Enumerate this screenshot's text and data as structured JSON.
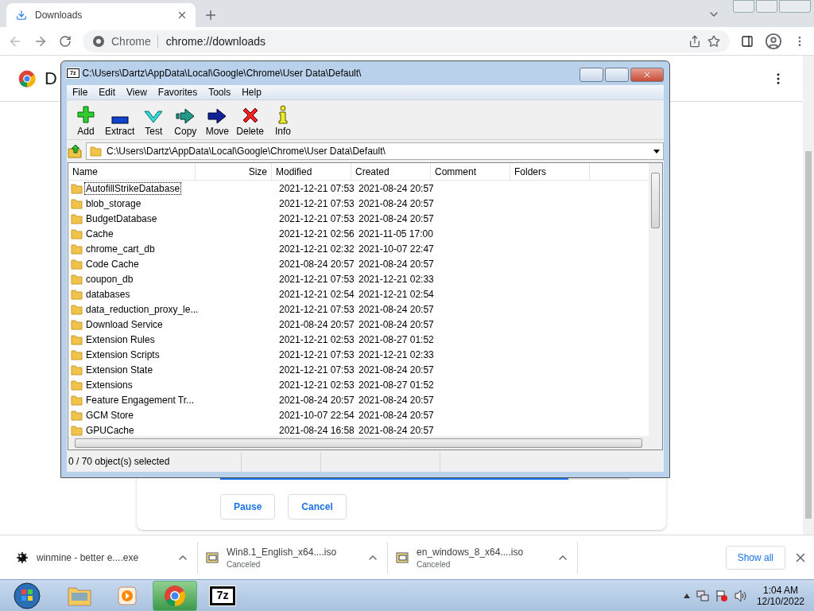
{
  "browser": {
    "tab": {
      "title": "Downloads"
    },
    "omnibox": {
      "site": "Chrome",
      "url": "chrome://downloads"
    }
  },
  "page": {
    "title": "D",
    "download": {
      "level": 0.85,
      "buttons": [
        "Pause",
        "Cancel"
      ]
    }
  },
  "archiver": {
    "icon_text": "7z",
    "title": "C:\\Users\\Dartz\\AppData\\Local\\Google\\Chrome\\User Data\\Default\\",
    "menu": [
      "File",
      "Edit",
      "View",
      "Favorites",
      "Tools",
      "Help"
    ],
    "toolbar": [
      {
        "kind": "add",
        "label": "Add"
      },
      {
        "kind": "extract",
        "label": "Extract"
      },
      {
        "kind": "test",
        "label": "Test"
      },
      {
        "kind": "copy",
        "label": "Copy"
      },
      {
        "kind": "move",
        "label": "Move"
      },
      {
        "kind": "delete",
        "label": "Delete"
      },
      {
        "kind": "info",
        "label": "Info"
      }
    ],
    "path": "C:\\Users\\Dartz\\AppData\\Local\\Google\\Chrome\\User Data\\Default\\",
    "columns": [
      "Name",
      "Size",
      "Modified",
      "Created",
      "Comment",
      "Folders"
    ],
    "rows": [
      {
        "name": "AutofillStrikeDatabase",
        "modified": "2021-12-21 07:53",
        "created": "2021-08-24 20:57",
        "focused": true
      },
      {
        "name": "blob_storage",
        "modified": "2021-12-21 07:53",
        "created": "2021-08-24 20:57",
        "focused": false
      },
      {
        "name": "BudgetDatabase",
        "modified": "2021-12-21 07:53",
        "created": "2021-08-24 20:57",
        "focused": false
      },
      {
        "name": "Cache",
        "modified": "2021-12-21 02:56",
        "created": "2021-11-05 17:00",
        "focused": false
      },
      {
        "name": "chrome_cart_db",
        "modified": "2021-12-21 02:32",
        "created": "2021-10-07 22:47",
        "focused": false
      },
      {
        "name": "Code Cache",
        "modified": "2021-08-24 20:57",
        "created": "2021-08-24 20:57",
        "focused": false
      },
      {
        "name": "coupon_db",
        "modified": "2021-12-21 07:53",
        "created": "2021-12-21 02:33",
        "focused": false
      },
      {
        "name": "databases",
        "modified": "2021-12-21 02:54",
        "created": "2021-12-21 02:54",
        "focused": false
      },
      {
        "name": "data_reduction_proxy_le...",
        "modified": "2021-12-21 07:53",
        "created": "2021-08-24 20:57",
        "focused": false
      },
      {
        "name": "Download Service",
        "modified": "2021-08-24 20:57",
        "created": "2021-08-24 20:57",
        "focused": false
      },
      {
        "name": "Extension Rules",
        "modified": "2021-12-21 02:53",
        "created": "2021-08-27 01:52",
        "focused": false
      },
      {
        "name": "Extension Scripts",
        "modified": "2021-12-21 07:53",
        "created": "2021-12-21 02:33",
        "focused": false
      },
      {
        "name": "Extension State",
        "modified": "2021-12-21 07:53",
        "created": "2021-08-24 20:57",
        "focused": false
      },
      {
        "name": "Extensions",
        "modified": "2021-12-21 02:53",
        "created": "2021-08-27 01:52",
        "focused": false
      },
      {
        "name": "Feature Engagement Tr...",
        "modified": "2021-08-24 20:57",
        "created": "2021-08-24 20:57",
        "focused": false
      },
      {
        "name": "GCM Store",
        "modified": "2021-10-07 22:54",
        "created": "2021-08-24 20:57",
        "focused": false
      },
      {
        "name": "GPUCache",
        "modified": "2021-08-24 16:58",
        "created": "2021-08-24 20:57",
        "focused": false
      }
    ],
    "status": "0 / 70 object(s) selected"
  },
  "shelf": {
    "items": [
      {
        "kind": "exe",
        "name": "winmine - better e....exe"
      },
      {
        "kind": "iso",
        "name": "Win8.1_English_x64....iso",
        "status": "Canceled"
      },
      {
        "kind": "iso",
        "name": "en_windows_8_x64....iso",
        "status": "Canceled"
      }
    ],
    "show_all": "Show all"
  },
  "taskbar": {
    "apps": [
      {
        "kind": "explorer",
        "selected": false
      },
      {
        "kind": "media",
        "selected": false
      },
      {
        "kind": "chrome",
        "selected": true
      },
      {
        "kind": "archiver",
        "label": "7z",
        "selected": false
      }
    ],
    "time": "1:04 AM",
    "date": "12/10/2022"
  }
}
